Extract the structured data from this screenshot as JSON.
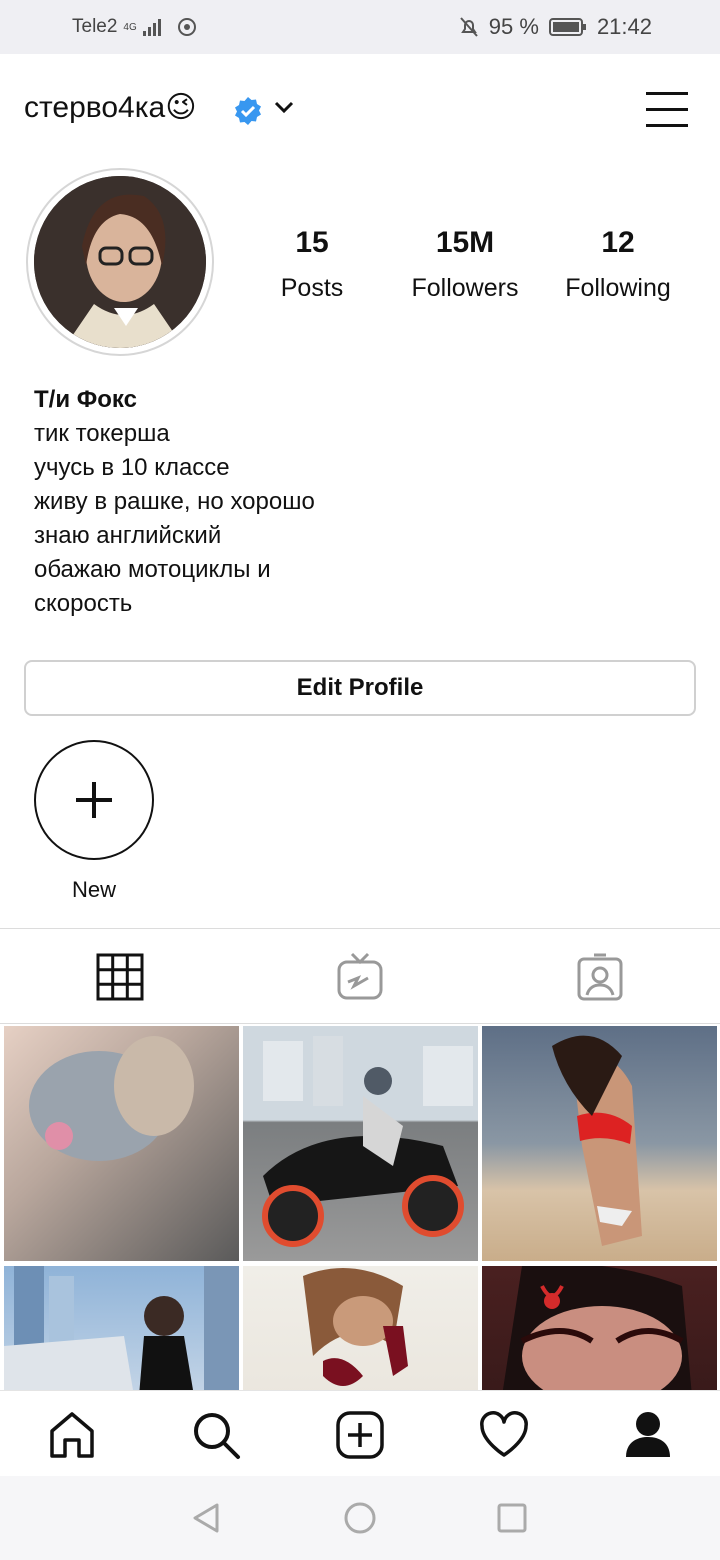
{
  "status_bar": {
    "carrier": "Tele2",
    "network": "4G",
    "battery": "95 %",
    "time": "21:42"
  },
  "header": {
    "username": "стерво4ка😉"
  },
  "profile": {
    "stats": [
      {
        "value": "15",
        "label": "Posts"
      },
      {
        "value": "15M",
        "label": "Followers"
      },
      {
        "value": "12",
        "label": "Following"
      }
    ],
    "bio": {
      "name": "Т/и Фокс",
      "lines": [
        "тик токерша",
        "учусь в 10 классе",
        "живу в рашке, но хорошо",
        "знаю английский",
        "обажаю мотоциклы и",
        "скорость"
      ]
    },
    "edit_button": "Edit Profile",
    "highlight_new_label": "New"
  },
  "icons": {
    "verified": "verified-badge-icon",
    "accent": "#3897f0"
  }
}
